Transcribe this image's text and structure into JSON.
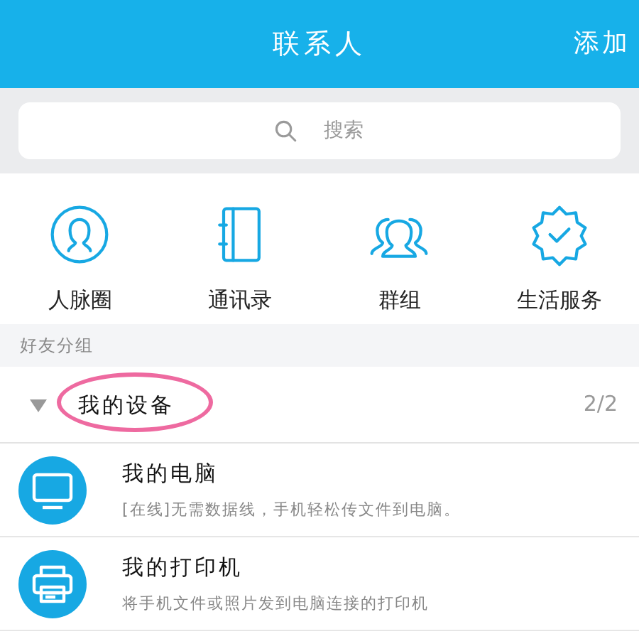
{
  "header": {
    "title": "联系人",
    "action": "添加"
  },
  "search": {
    "placeholder": "搜索"
  },
  "shortcuts": [
    {
      "kind": "contacts-circle",
      "label": "人脉圈"
    },
    {
      "kind": "address-book",
      "label": "通讯录"
    },
    {
      "kind": "group",
      "label": "群组"
    },
    {
      "kind": "service",
      "label": "生活服务"
    }
  ],
  "section_label": "好友分组",
  "groups": [
    {
      "name": "我的设备",
      "count": "2/2",
      "expanded": true,
      "highlighted": true,
      "items": [
        {
          "kind": "computer",
          "name": "我的电脑",
          "status": "[在线]",
          "description": "无需数据线，手机轻松传文件到电脑。"
        },
        {
          "kind": "printer",
          "name": "我的打印机",
          "description": "将手机文件或照片发到电脑连接的打印机"
        }
      ]
    }
  ]
}
